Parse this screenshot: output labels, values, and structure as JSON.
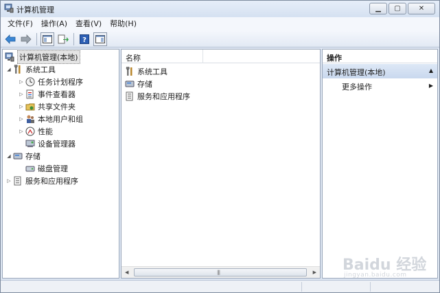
{
  "window": {
    "title": "计算机管理"
  },
  "menu": [
    "文件(F)",
    "操作(A)",
    "查看(V)",
    "帮助(H)"
  ],
  "tree": {
    "root": "计算机管理(本地)",
    "items": [
      {
        "label": "系统工具",
        "icon": "tools-icon",
        "expanded": true
      },
      {
        "label": "任务计划程序",
        "icon": "clock-icon"
      },
      {
        "label": "事件查看器",
        "icon": "event-viewer-icon"
      },
      {
        "label": "共享文件夹",
        "icon": "shared-folder-icon"
      },
      {
        "label": "本地用户和组",
        "icon": "users-icon"
      },
      {
        "label": "性能",
        "icon": "performance-icon"
      },
      {
        "label": "设备管理器",
        "icon": "device-manager-icon"
      },
      {
        "label": "存储",
        "icon": "storage-icon",
        "expanded": true
      },
      {
        "label": "磁盘管理",
        "icon": "disk-icon"
      },
      {
        "label": "服务和应用程序",
        "icon": "services-icon"
      }
    ]
  },
  "list": {
    "column": "名称",
    "rows": [
      "系统工具",
      "存储",
      "服务和应用程序"
    ]
  },
  "actions": {
    "header": "操作",
    "section": "计算机管理(本地)",
    "item": "更多操作"
  },
  "watermark": {
    "main": "Baidu 经验",
    "sub": "jingyan.baidu.com"
  }
}
